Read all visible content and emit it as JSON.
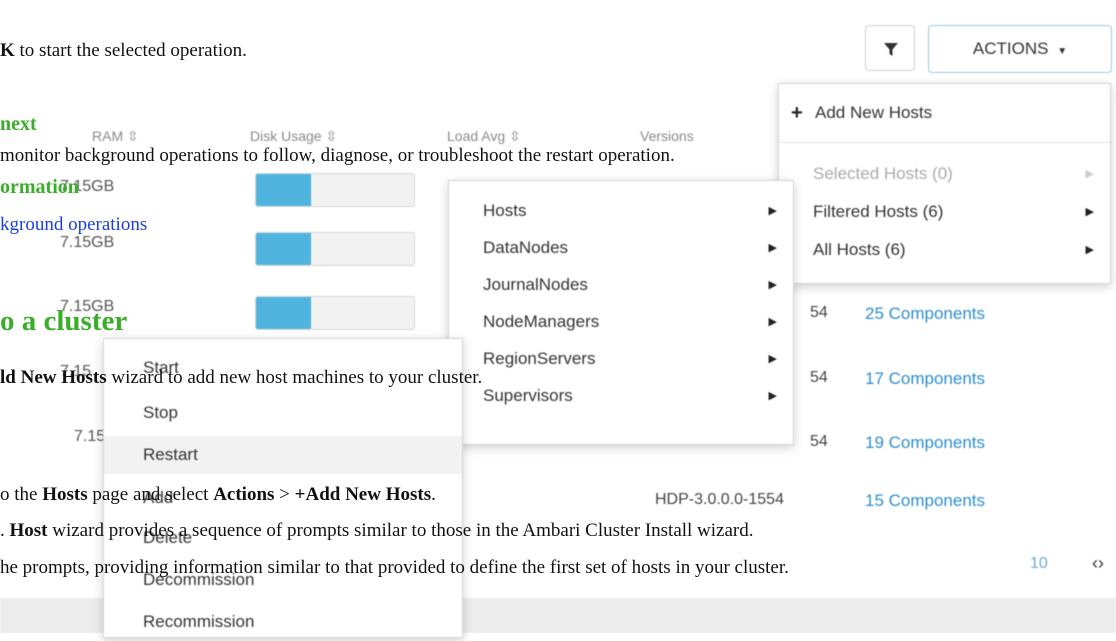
{
  "doc": {
    "line_ok_start": "K",
    "line_ok_rest": " to start the selected operation.",
    "next_heading": "next",
    "monitor_line": "monitor background operations to follow, diagnose, or troubleshoot the restart operation.",
    "more_info": "ormation",
    "bg_ops_link": "kground operations",
    "cluster_heading": "o a cluster",
    "add_hosts_bold": "ld New Hosts",
    "add_hosts_rest": " wizard to add new host machines to your cluster.",
    "step1_pre": "o the ",
    "step1_hosts": "Hosts",
    "step1_mid": " page and select ",
    "step1_actions": "Actions",
    "step1_gt": " > ",
    "step1_add": "+Add New Hosts",
    "step1_end": ".",
    "step2_host": "Host",
    "step2_rest": " wizard provides a sequence of prompts similar to those in the Ambari Cluster Install wizard.",
    "step3": "he prompts, providing information similar to that provided to define the first set of hosts in your cluster."
  },
  "table": {
    "headers": {
      "ram": "RAM",
      "disk": "Disk Usage",
      "load": "Load Avg",
      "versions": "Versions"
    },
    "rows": [
      {
        "ram": "7.15GB",
        "disk_fill": 0.35,
        "version": "",
        "components": ""
      },
      {
        "ram": "7.15GB",
        "disk_fill": 0.35,
        "version": "",
        "components": ""
      },
      {
        "ram": "7.15GB",
        "disk_fill": 0.35,
        "version": "54",
        "components": "25 Components"
      },
      {
        "ram": "7.15",
        "disk_fill": 0,
        "version": "54",
        "components": "17 Components"
      },
      {
        "ram": "7.15",
        "disk_fill": 0,
        "version": "54",
        "components": "19 Components"
      },
      {
        "ram": "",
        "disk_fill": 0,
        "version": "HDP-3.0.0.0-1554",
        "components": "15 Components"
      }
    ],
    "pager_partial": "10"
  },
  "toolbar": {
    "filter_icon": "filter-icon",
    "actions_label": "ACTIONS"
  },
  "actions_menu": {
    "add_new_hosts": "Add New Hosts",
    "selected_hosts": "Selected Hosts (0)",
    "filtered_hosts": "Filtered Hosts (6)",
    "all_hosts": "All Hosts (6)"
  },
  "hosts_submenu": [
    "Hosts",
    "DataNodes",
    "JournalNodes",
    "NodeManagers",
    "RegionServers",
    "Supervisors"
  ],
  "operations_menu": [
    "Start",
    "Stop",
    "Restart",
    "Add",
    "Delete",
    "Decommission",
    "Recommission"
  ],
  "colors": {
    "accent_green": "#3aae2a",
    "link_blue": "#1a3fe0",
    "bar_fill": "#4fb5de",
    "components_blue": "#2d8ed0"
  }
}
